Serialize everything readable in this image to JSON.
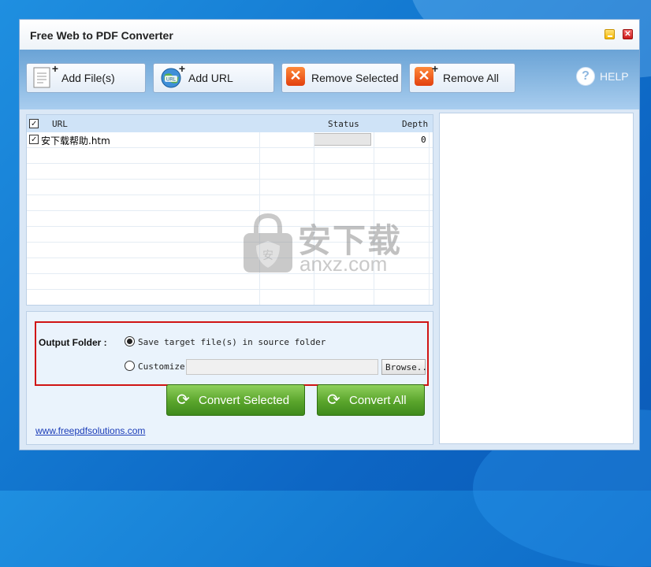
{
  "window": {
    "title": "Free Web to PDF Converter"
  },
  "toolbar": {
    "add_files": "Add File(s)",
    "add_url": "Add URL",
    "remove_selected": "Remove Selected",
    "remove_all": "Remove All",
    "help": "HELP"
  },
  "list": {
    "columns": {
      "url": "URL",
      "status": "Status",
      "depth": "Depth"
    },
    "rows": [
      {
        "url": "安下载帮助.htm",
        "status": "",
        "depth": "0",
        "checked": true
      }
    ]
  },
  "output": {
    "label": "Output Folder :",
    "option_source": "Save target file(s) in source folder",
    "option_customize": "Customize",
    "custom_path": "",
    "browse": "Browse..",
    "selected_option": "source"
  },
  "actions": {
    "convert_selected": "Convert Selected",
    "convert_all": "Convert All"
  },
  "footer": {
    "link": "www.freepdfsolutions.com"
  },
  "watermark": {
    "cn": "安下载",
    "en": "anxz.com"
  },
  "colors": {
    "accent_red": "#d01414",
    "convert_green": "#5aa52c",
    "toolbar_blue": "#8fbce4"
  }
}
